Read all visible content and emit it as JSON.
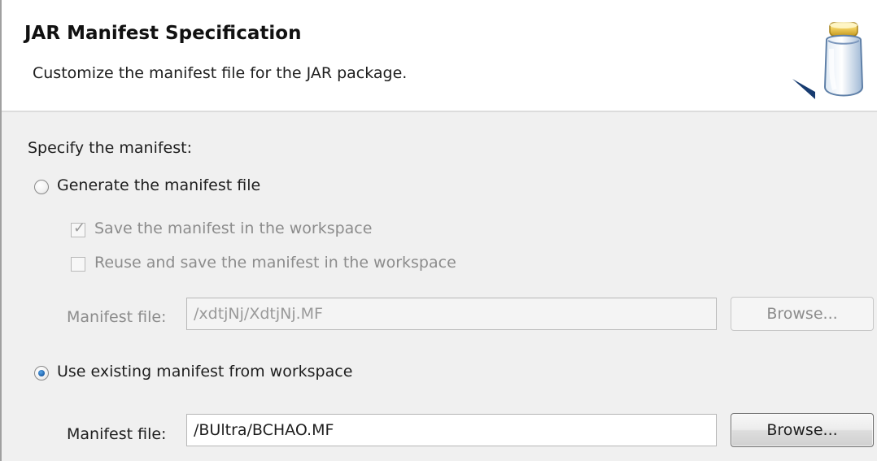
{
  "header": {
    "title": "JAR Manifest Specification",
    "subtitle": "Customize the manifest file for the JAR package."
  },
  "content": {
    "specify_label": "Specify the manifest:",
    "generate_option": {
      "label": "Generate the manifest file",
      "selected": false
    },
    "save_workspace": {
      "label": "Save the manifest in the workspace",
      "checked": true,
      "enabled": false
    },
    "reuse_workspace": {
      "label": "Reuse and save the manifest in the workspace",
      "checked": false,
      "enabled": false
    },
    "generated_manifest": {
      "label": "Manifest file:",
      "value": "/xdtjNj/XdtjNj.MF",
      "browse_label": "Browse...",
      "enabled": false
    },
    "existing_option": {
      "label": "Use existing manifest from workspace",
      "selected": true
    },
    "existing_manifest": {
      "label": "Manifest file:",
      "value": "/BUltra/BCHAO.MF",
      "browse_label": "Browse...",
      "enabled": true
    }
  },
  "icons": {
    "header_icon": "jar-icon",
    "radio_icon": "radio-button-icon",
    "checkbox_icon": "checkbox-icon",
    "check_mark": "check-mark-icon"
  },
  "colors": {
    "page_background": "#f0f0f0",
    "header_background": "#ffffff",
    "disabled_text": "#8c8c8c",
    "selected_radio": "#1b5ea8"
  }
}
